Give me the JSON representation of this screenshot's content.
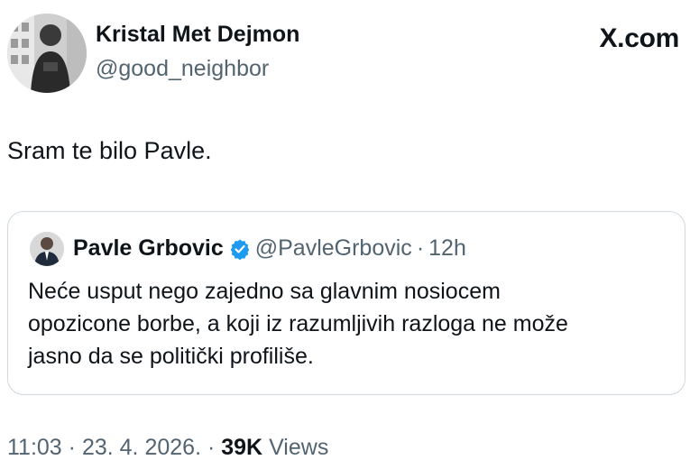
{
  "author": {
    "name": "Kristal Met Dejmon",
    "handle": "@good_neighbor"
  },
  "brand": "X.com",
  "tweet": {
    "text": "Sram te bilo Pavle."
  },
  "quote": {
    "name": "Pavle Grbovic",
    "verified_icon": "verified-badge-icon",
    "handle": "@PavleGrbovic",
    "separator": "·",
    "time": "12h",
    "lines": [
      "Neće usput nego zajedno sa glavnim nosiocem",
      "opozicone borbe, a koji iz razumljivih razloga ne može",
      "jasno da se politički profiliše."
    ]
  },
  "meta": {
    "time": "11:03",
    "separator1": "·",
    "date": "23. 4. 2026.",
    "separator2": "·",
    "views_count": "39K",
    "views_label": "Views"
  },
  "colors": {
    "text": "#0f1419",
    "secondary": "#536471",
    "border": "#cfd9de",
    "verified": "#1d9bf0"
  }
}
